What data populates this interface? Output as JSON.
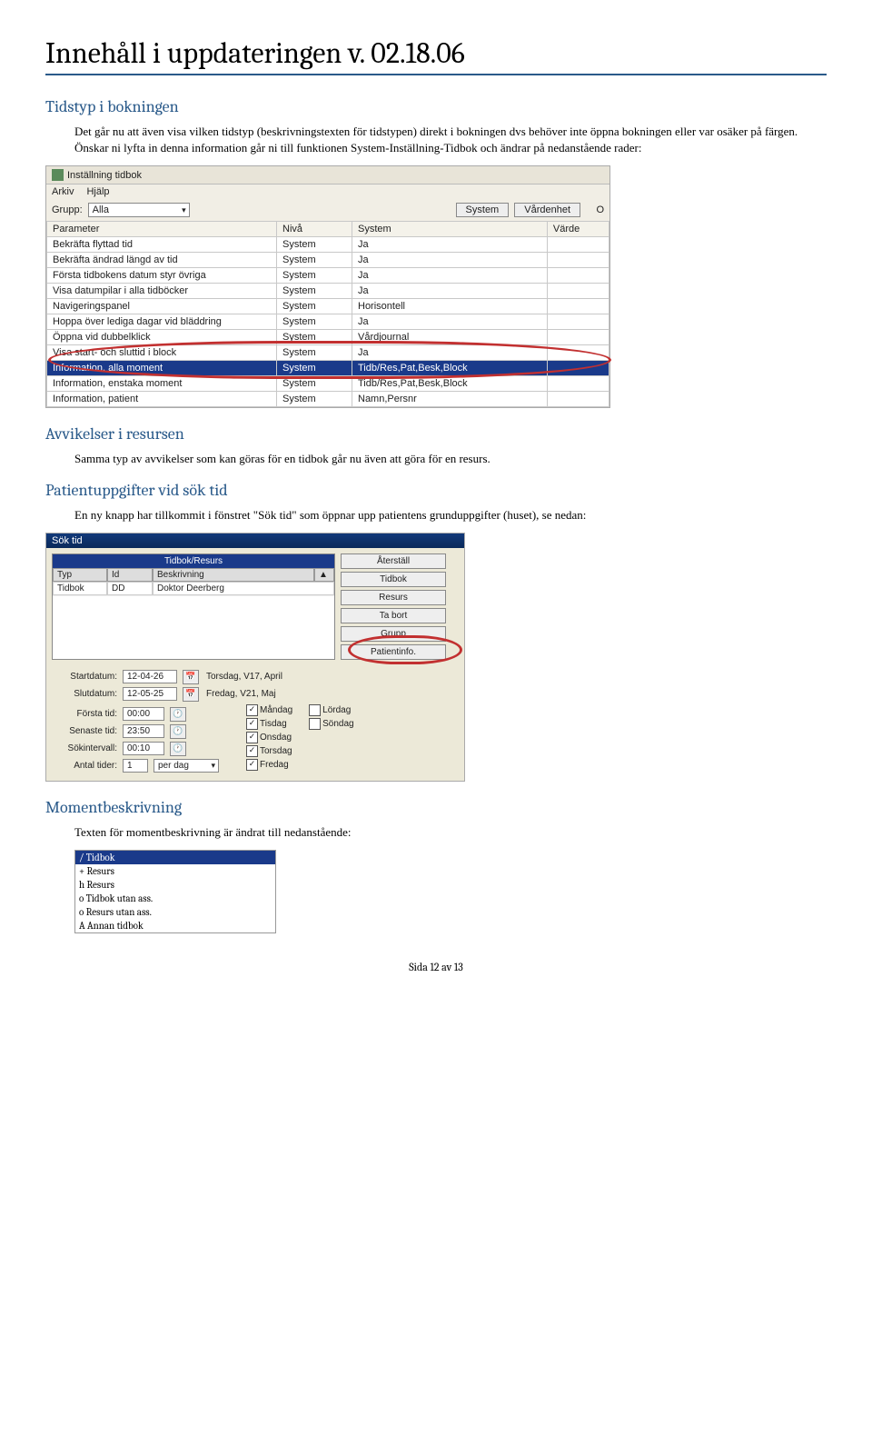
{
  "title": "Innehåll i uppdateringen v. 02.18.06",
  "section1": {
    "heading": "Tidstyp i bokningen",
    "body": "Det går nu att även visa vilken tidstyp (beskrivningstexten för tidstypen) direkt i bokningen dvs behöver inte öppna bokningen eller var osäker på färgen. Önskar ni lyfta in denna information går ni till funktionen System-Inställning-Tidbok och ändrar på nedanstående rader:"
  },
  "screenshot1": {
    "windowTitle": "Inställning tidbok",
    "menu": [
      "Arkiv",
      "Hjälp"
    ],
    "toolbar": {
      "gruppLabel": "Grupp:",
      "gruppValue": "Alla",
      "systemBtn": "System",
      "vardenhetBtn": "Vårdenhet",
      "colO": "O"
    },
    "headers": [
      "Parameter",
      "Nivå",
      "System",
      "Värde"
    ],
    "rows": [
      {
        "p": "Bekräfta flyttad tid",
        "n": "System",
        "s": "Ja"
      },
      {
        "p": "Bekräfta ändrad längd av tid",
        "n": "System",
        "s": "Ja"
      },
      {
        "p": "Första tidbokens datum styr övriga",
        "n": "System",
        "s": "Ja"
      },
      {
        "p": "Visa datumpilar i alla tidböcker",
        "n": "System",
        "s": "Ja"
      },
      {
        "p": "Navigeringspanel",
        "n": "System",
        "s": "Horisontell"
      },
      {
        "p": "Hoppa över lediga dagar vid bläddring",
        "n": "System",
        "s": "Ja"
      },
      {
        "p": "Öppna vid dubbelklick",
        "n": "System",
        "s": "Vårdjournal"
      },
      {
        "p": "Visa start- och sluttid i block",
        "n": "System",
        "s": "Ja"
      },
      {
        "p": "Information, alla moment",
        "n": "System",
        "s": "Tidb/Res,Pat,Besk,Block",
        "hl": true
      },
      {
        "p": "Information, enstaka moment",
        "n": "System",
        "s": "Tidb/Res,Pat,Besk,Block"
      },
      {
        "p": "Information, patient",
        "n": "System",
        "s": "Namn,Persnr"
      }
    ]
  },
  "section2": {
    "heading": "Avvikelser i resursen",
    "body": "Samma typ av avvikelser som kan göras för en tidbok går nu även att göra för en resurs."
  },
  "section3": {
    "heading": "Patientuppgifter vid sök tid",
    "body": "En ny knapp har tillkommit i fönstret \"Sök tid\" som öppnar upp patientens grunduppgifter (huset), se nedan:"
  },
  "screenshot2": {
    "windowTitle": "Sök tid",
    "listHeader": "Tidbok/Resurs",
    "cols": [
      "Typ",
      "Id",
      "Beskrivning"
    ],
    "row": {
      "typ": "Tidbok",
      "id": "DD",
      "besk": "Doktor Deerberg"
    },
    "sideButtons": [
      "Återställ",
      "Tidbok",
      "Resurs",
      "Ta bort",
      "Grupp",
      "Patientinfo."
    ],
    "fields": {
      "startLabel": "Startdatum:",
      "startVal": "12-04-26",
      "startDay": "Torsdag, V17, April",
      "slutLabel": "Slutdatum:",
      "slutVal": "12-05-25",
      "slutDay": "Fredag, V21, Maj",
      "forstaLabel": "Första tid:",
      "forstaVal": "00:00",
      "senasteLabel": "Senaste tid:",
      "senasteVal": "23:50",
      "sokLabel": "Sökintervall:",
      "sokVal": "00:10",
      "antalLabel": "Antal tider:",
      "antalVal": "1",
      "antalUnit": "per dag"
    },
    "days": [
      {
        "n": "Måndag",
        "c": true
      },
      {
        "n": "Tisdag",
        "c": true
      },
      {
        "n": "Onsdag",
        "c": true
      },
      {
        "n": "Torsdag",
        "c": true
      },
      {
        "n": "Fredag",
        "c": true
      },
      {
        "n": "Lördag",
        "c": false
      },
      {
        "n": "Söndag",
        "c": false
      }
    ]
  },
  "section4": {
    "heading": "Momentbeskrivning",
    "body": "Texten för momentbeskrivning är ändrat till nedanstående:"
  },
  "screenshot3": {
    "items": [
      {
        "t": "/ Tidbok",
        "hl": true
      },
      {
        "t": "+ Resurs"
      },
      {
        "t": "h Resurs"
      },
      {
        "t": "o Tidbok utan ass."
      },
      {
        "t": "o Resurs utan ass."
      },
      {
        "t": "A Annan tidbok"
      }
    ]
  },
  "footer": "Sida 12 av 13"
}
